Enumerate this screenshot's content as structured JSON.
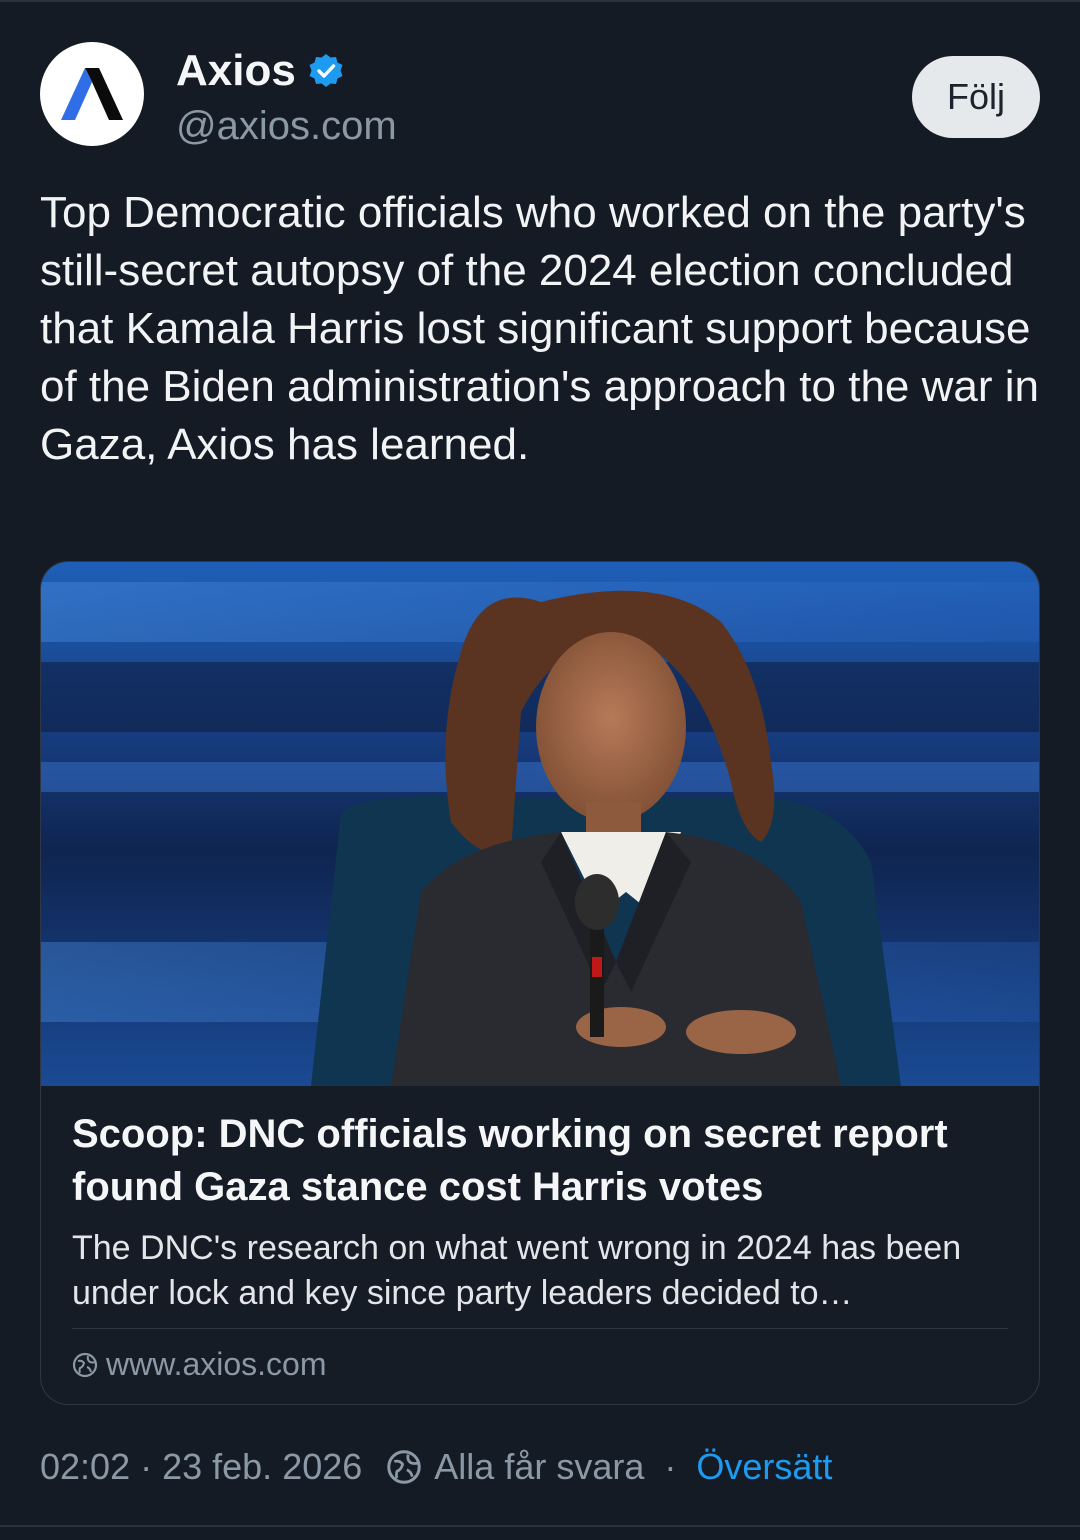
{
  "account": {
    "display_name": "Axios",
    "handle": "@axios.com",
    "follow_label": "Följ"
  },
  "tweet": {
    "text": "Top Democratic officials who worked on the party's still-secret autopsy of the 2024 election concluded that Kamala Harris lost significant support because of the Biden administration's approach to the war in Gaza, Axios has learned."
  },
  "link_card": {
    "title": "Scoop: DNC officials working on secret report found Gaza stance cost Harris votes",
    "description": "The DNC's research on what went wrong in 2024 has been under lock and key since party leaders decided to…",
    "domain": "www.axios.com"
  },
  "meta": {
    "time": "02:02",
    "date": "23 feb. 2026",
    "reply_setting": "Alla får svara",
    "translate_label": "Översätt"
  },
  "colors": {
    "background": "#151b24",
    "accent": "#1d9bf0",
    "secondary_text": "#8b98a5"
  },
  "icons": {
    "verified": "verified-badge-icon",
    "globe": "globe-icon",
    "reply_setting": "globe-icon"
  }
}
